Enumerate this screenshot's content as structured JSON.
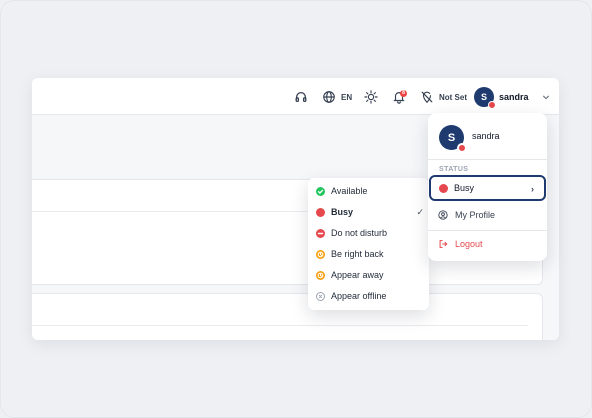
{
  "topbar": {
    "language": "EN",
    "notification_count": "8",
    "location": "Not Set",
    "username": "sandra",
    "avatar_initial": "S"
  },
  "profile_menu": {
    "avatar_initial": "S",
    "name": "sandra",
    "section_label": "STATUS",
    "current_status": "Busy",
    "my_profile": "My Profile",
    "logout": "Logout"
  },
  "status_menu": {
    "items": [
      {
        "label": "Available",
        "icon": "check-circle-icon",
        "color": "#22c55e"
      },
      {
        "label": "Busy",
        "icon": "busy-dot-icon",
        "color": "#e5484d",
        "selected": true
      },
      {
        "label": "Do not disturb",
        "icon": "minus-circle-icon",
        "color": "#e5484d"
      },
      {
        "label": "Be right back",
        "icon": "clock-icon",
        "color": "#f59e0b"
      },
      {
        "label": "Appear away",
        "icon": "clock-icon",
        "color": "#f59e0b"
      },
      {
        "label": "Appear offline",
        "icon": "x-circle-icon",
        "color": "#9ca3af"
      }
    ]
  },
  "colors": {
    "accent": "#1e3a6e",
    "busy": "#e5484d",
    "available": "#22c55e",
    "away": "#f59e0b",
    "offline": "#9ca3af"
  }
}
